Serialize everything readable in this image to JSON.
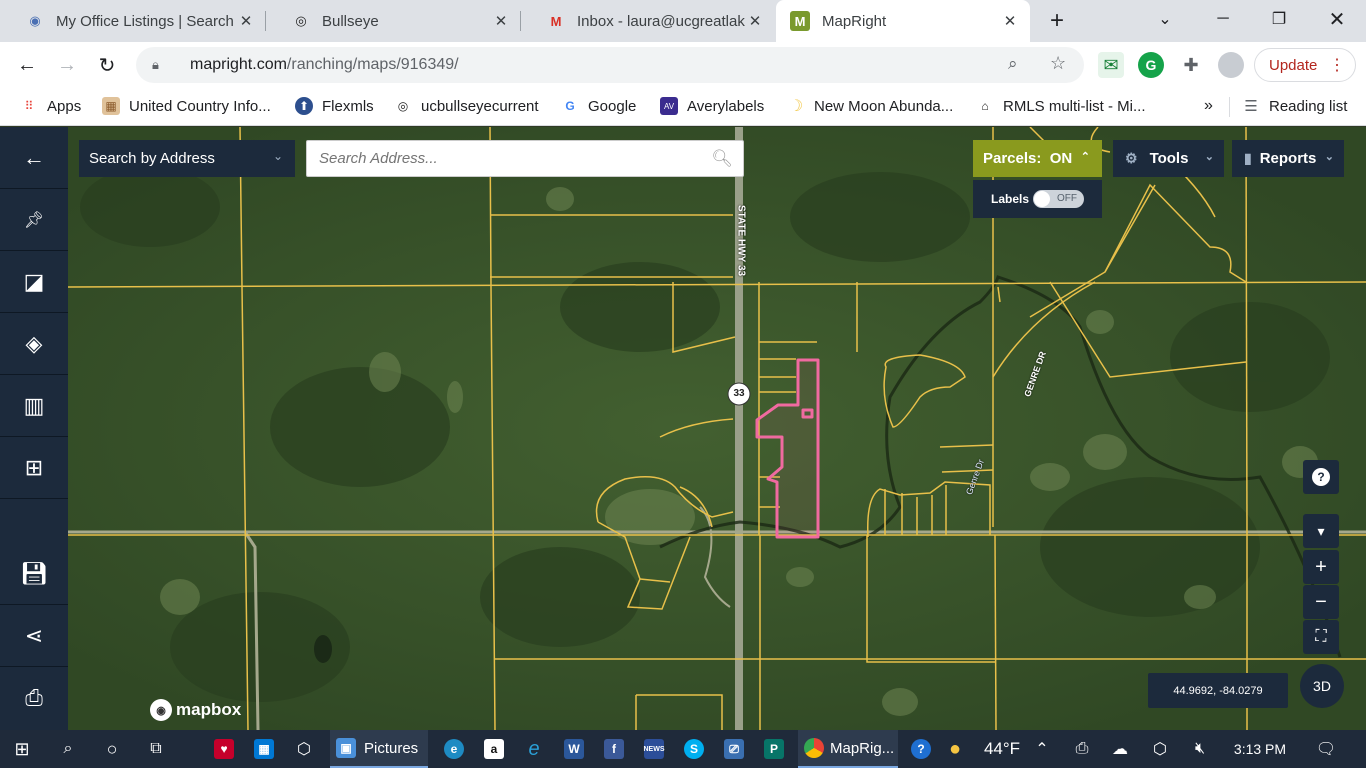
{
  "browser": {
    "tabs": [
      {
        "title": "My Office Listings | Search",
        "icon": "location-pin-icon",
        "active": false
      },
      {
        "title": "Bullseye",
        "icon": "bullseye-icon",
        "active": false
      },
      {
        "title": "Inbox - laura@ucgreatlake",
        "icon": "gmail-icon",
        "active": false
      },
      {
        "title": "MapRight",
        "icon": "mapright-icon",
        "active": true
      }
    ],
    "new_tab": "+",
    "url_host": "mapright.com",
    "url_path": "/ranching/maps/916349/",
    "update_label": "Update",
    "bookmarks": [
      {
        "label": "Apps",
        "icon": "apps-grid-icon"
      },
      {
        "label": "United Country Info...",
        "icon": "united-country-icon"
      },
      {
        "label": "Flexmls",
        "icon": "flexmls-icon"
      },
      {
        "label": "ucbullseyecurrent",
        "icon": "bullseye-icon"
      },
      {
        "label": "Google",
        "icon": "google-icon"
      },
      {
        "label": "Averylabels",
        "icon": "avery-icon"
      },
      {
        "label": "New Moon Abunda...",
        "icon": "moon-icon"
      },
      {
        "label": "RMLS multi-list - Mi...",
        "icon": "rmls-icon"
      }
    ],
    "bookmarks_overflow": "»",
    "reading_list": "Reading list"
  },
  "map": {
    "search_mode": "Search by Address",
    "search_placeholder": "Search Address...",
    "parcels_label": "Parcels:",
    "parcels_state": "ON",
    "labels_label": "Labels",
    "labels_state": "OFF",
    "tools_label": "Tools",
    "reports_label": "Reports",
    "coordinates": "44.9692, -84.0279",
    "btn_3d": "3D",
    "attribution": "mapbox",
    "road_label_hwy": "STATE HWY 33",
    "road_shield": "33",
    "road_label_genre": "GENRE DR",
    "road_label_genre2": "Genre Dr",
    "sidebar_icons": [
      "back-arrow-icon",
      "pin-icon",
      "draw-shapes-icon",
      "layers-icon",
      "map-icon",
      "add-layer-icon",
      "save-icon",
      "share-icon",
      "print-icon"
    ],
    "colors": {
      "parcel_line": "#e8c04a",
      "highlight_parcel": "#f06aa0",
      "panel": "#1c2a3c",
      "parcels_button": "#8a9a1e"
    }
  },
  "taskbar": {
    "pictures_label": "Pictures",
    "chrome_label": "MapRig...",
    "temperature": "44°F",
    "time": "3:13 PM"
  }
}
